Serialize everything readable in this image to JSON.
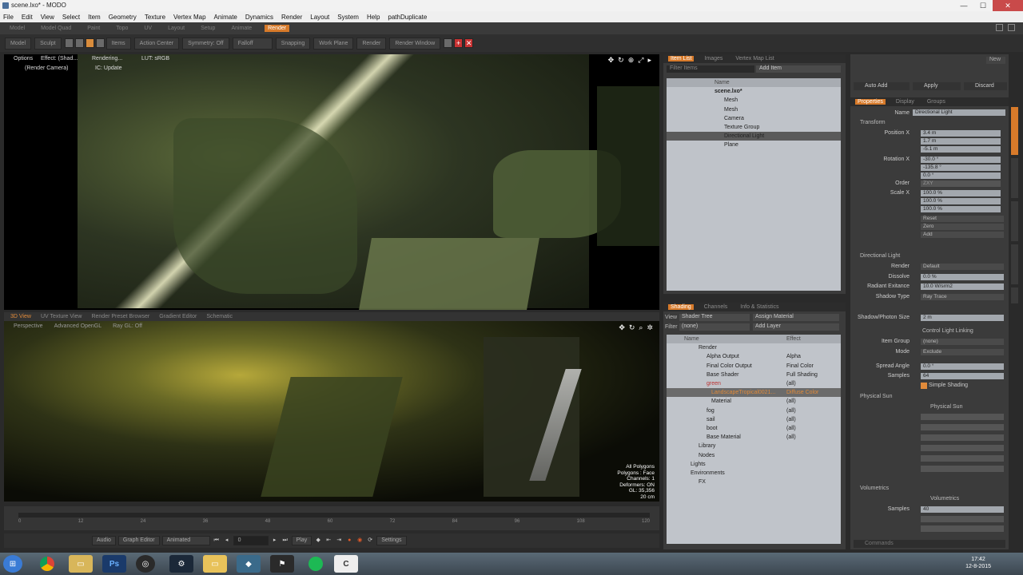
{
  "window": {
    "title": "scene.lxo* - MODO"
  },
  "menu": [
    "File",
    "Edit",
    "View",
    "Select",
    "Item",
    "Geometry",
    "Texture",
    "Vertex Map",
    "Animate",
    "Dynamics",
    "Render",
    "Layout",
    "System",
    "Help",
    "pathDuplicate"
  ],
  "layouts": {
    "tabs": [
      "Model",
      "Model Quad",
      "Paint",
      "Topo",
      "UV",
      "Layout",
      "Setup",
      "Animate",
      "Render"
    ],
    "active": "Render"
  },
  "toolbar": {
    "model": "Model",
    "sculpt": "Sculpt",
    "items": "Items",
    "action_center": "Action Center",
    "symmetry": "Symmetry: Off",
    "falloff": "Falloff",
    "snapping": "Snapping",
    "work_plane": "Work Plane",
    "render": "Render",
    "render_window": "Render Window"
  },
  "preview": {
    "options": "Options",
    "effect": "Effect: (Shad...",
    "rendering": "Rendering...",
    "lut": "LUT: sRGB",
    "camera": "(Render Camera)",
    "ic": "IC: Update"
  },
  "viewport_tabs": {
    "items": [
      "3D View",
      "UV Texture View",
      "Render Preset Browser",
      "Gradient Editor",
      "Schematic"
    ],
    "active": "3D View"
  },
  "viewport3d": {
    "perspective": "Perspective",
    "shading": "Advanced OpenGL",
    "ray": "Ray GL: Off",
    "stats": [
      "All Polygons",
      "Polygons : Face",
      "Channels: 1",
      "Deformers: ON",
      "GL: 35,356",
      "20 cm"
    ]
  },
  "timeline": {
    "ticks": [
      "0",
      "12",
      "24",
      "36",
      "48",
      "60",
      "72",
      "84",
      "96",
      "108",
      "120"
    ]
  },
  "transport": {
    "audio": "Audio",
    "graph_editor": "Graph Editor",
    "animated": "Animated",
    "frame": "0",
    "play": "Play",
    "settings": "Settings"
  },
  "itemlist": {
    "tabs": [
      "Item List",
      "Images",
      "Vertex Map List"
    ],
    "filter": "Filter Items",
    "add_item": "Add Item",
    "column": "Name",
    "items": [
      {
        "label": "scene.lxo*",
        "sel": false
      },
      {
        "label": "Mesh",
        "sel": false
      },
      {
        "label": "Mesh",
        "sel": false
      },
      {
        "label": "Camera",
        "sel": false
      },
      {
        "label": "Texture Group",
        "sel": false
      },
      {
        "label": "Directional Light",
        "sel": true
      },
      {
        "label": "Plane",
        "sel": false
      }
    ]
  },
  "shading": {
    "tabs": [
      "Shading",
      "Channels",
      "Info & Statistics"
    ],
    "view": "View",
    "view_val": "Shader Tree",
    "assign": "Assign Material",
    "filter": "Filter",
    "filter_val": "(none)",
    "add_layer": "Add Layer",
    "col_name": "Name",
    "col_effect": "Effect",
    "rows": [
      {
        "name": "Render",
        "effect": "",
        "sel": false
      },
      {
        "name": "Alpha Output",
        "effect": "Alpha",
        "sel": false
      },
      {
        "name": "Final Color Output",
        "effect": "Final Color",
        "sel": false
      },
      {
        "name": "Base Shader",
        "effect": "Full Shading",
        "sel": false
      },
      {
        "name": "green",
        "effect": "(all)",
        "sel": false
      },
      {
        "name": "LandscapeTropical0021...",
        "effect": "Diffuse Color",
        "sel": true
      },
      {
        "name": "Material",
        "effect": "(all)",
        "sel": false
      },
      {
        "name": "fog",
        "effect": "(all)",
        "sel": false
      },
      {
        "name": "sail",
        "effect": "(all)",
        "sel": false
      },
      {
        "name": "boot",
        "effect": "(all)",
        "sel": false
      },
      {
        "name": "Base Material",
        "effect": "(all)",
        "sel": false
      },
      {
        "name": "Library",
        "effect": "",
        "sel": false
      },
      {
        "name": "Nodes",
        "effect": "",
        "sel": false
      },
      {
        "name": "Lights",
        "effect": "",
        "sel": false
      },
      {
        "name": "Environments",
        "effect": "",
        "sel": false
      },
      {
        "name": "FX",
        "effect": "",
        "sel": false
      }
    ]
  },
  "props": {
    "top": {
      "auto_add": "Auto Add",
      "apply": "Apply",
      "discard": "Discard",
      "new": "New"
    },
    "tabs": [
      "Properties",
      "Display",
      "Groups"
    ],
    "name_label": "Name",
    "name_val": "Directional Light",
    "transform": "Transform",
    "position_label": "Position X",
    "position": [
      "3.4 m",
      "1.7 m",
      "-5.1 m"
    ],
    "rotation_label": "Rotation X",
    "rotation": [
      "-30.0 °",
      "-135.8 °",
      "0.0 °"
    ],
    "order_label": "Order",
    "order": "ZXY",
    "scale_label": "Scale X",
    "scale": [
      "100.0 %",
      "100.0 %",
      "100.0 %"
    ],
    "reset": "Reset",
    "zero": "Zero",
    "add": "Add",
    "light_section": "Directional Light",
    "render_label": "Render",
    "render_val": "Default",
    "dissolve_label": "Dissolve",
    "dissolve_val": "0.0 %",
    "radiance_label": "Radiant Exitance",
    "radiance_val": "10.0 W/srm2",
    "shadow_label": "Shadow Type",
    "shadow_val": "Ray Trace",
    "photon_label": "Shadow/Photon Size",
    "photon_val": "2 m",
    "linking": "Control Light Linking",
    "item_group_label": "Item Group",
    "item_group_val": "(none)",
    "mode_label": "Mode",
    "mode_val": "Exclude",
    "spread_label": "Spread Angle",
    "spread_val": "0.0 °",
    "samples_label": "Samples",
    "samples_val": "64",
    "simple_shading": "Simple Shading",
    "physical_sun": "Physical Sun",
    "physical_sun_cb": "Physical Sun",
    "volumetrics": "Volumetrics",
    "volumetrics_cb": "Volumetrics",
    "vol_samples_label": "Samples",
    "vol_samples_val": "40",
    "commands": "Commands"
  },
  "clock": {
    "time": "17:42",
    "date": "12-8-2015"
  }
}
